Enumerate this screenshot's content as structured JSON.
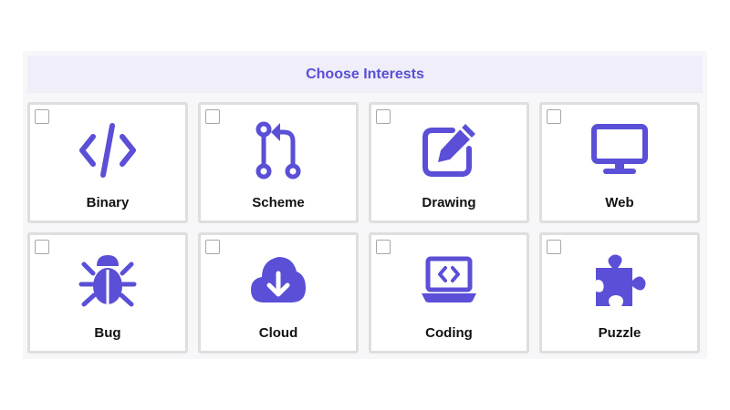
{
  "header": {
    "title": "Choose Interests"
  },
  "accent_color": "#5a4fd6",
  "cards": [
    {
      "label": "Binary",
      "icon": "code-icon",
      "checked": false
    },
    {
      "label": "Scheme",
      "icon": "git-pull-icon",
      "checked": false
    },
    {
      "label": "Drawing",
      "icon": "edit-icon",
      "checked": false
    },
    {
      "label": "Web",
      "icon": "monitor-icon",
      "checked": false
    },
    {
      "label": "Bug",
      "icon": "bug-icon",
      "checked": false
    },
    {
      "label": "Cloud",
      "icon": "cloud-download-icon",
      "checked": false
    },
    {
      "label": "Coding",
      "icon": "laptop-code-icon",
      "checked": false
    },
    {
      "label": "Puzzle",
      "icon": "puzzle-icon",
      "checked": false
    }
  ]
}
